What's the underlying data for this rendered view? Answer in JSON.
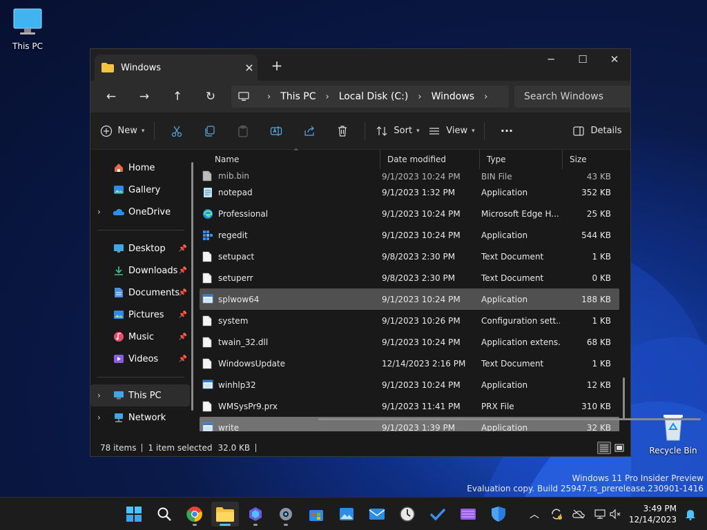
{
  "desktop": {
    "icons": [
      {
        "label": "This PC"
      },
      {
        "label": "Recycle Bin"
      }
    ],
    "watermark": {
      "line1": "Windows 11 Pro Insider Preview",
      "line2": "Evaluation copy. Build 25947.rs_prerelease.230901-1416"
    }
  },
  "window": {
    "tab_title": "Windows",
    "controls": {
      "minimize": "─",
      "maximize": "☐",
      "close": "✕"
    }
  },
  "navbar": {
    "breadcrumb": [
      "This PC",
      "Local Disk (C:)",
      "Windows"
    ],
    "search_placeholder": "Search Windows"
  },
  "commandbar": {
    "new_label": "New",
    "sort_label": "Sort",
    "view_label": "View",
    "more_label": "···",
    "details_label": "Details"
  },
  "sidebar": {
    "items": [
      {
        "label": "Home",
        "icon": "home-icon"
      },
      {
        "label": "Gallery",
        "icon": "gallery-icon"
      },
      {
        "label": "OneDrive",
        "icon": "onedrive-icon"
      },
      {
        "label": "Desktop",
        "icon": "desktop-icon"
      },
      {
        "label": "Downloads",
        "icon": "downloads-icon"
      },
      {
        "label": "Documents",
        "icon": "documents-icon"
      },
      {
        "label": "Pictures",
        "icon": "pictures-icon"
      },
      {
        "label": "Music",
        "icon": "music-icon"
      },
      {
        "label": "Videos",
        "icon": "videos-icon"
      },
      {
        "label": "This PC",
        "icon": "pc-icon"
      },
      {
        "label": "Network",
        "icon": "network-icon"
      }
    ]
  },
  "columns": {
    "name": "Name",
    "date": "Date modified",
    "type": "Type",
    "size": "Size"
  },
  "files": [
    {
      "name": "mib.bin",
      "date": "9/1/2023 10:24 PM",
      "type": "BIN File",
      "size": "43 KB",
      "icon": "file"
    },
    {
      "name": "notepad",
      "date": "9/1/2023 1:32 PM",
      "type": "Application",
      "size": "352 KB",
      "icon": "notepad"
    },
    {
      "name": "Professional",
      "date": "9/1/2023 10:24 PM",
      "type": "Microsoft Edge H...",
      "size": "25 KB",
      "icon": "edge"
    },
    {
      "name": "regedit",
      "date": "9/1/2023 10:24 PM",
      "type": "Application",
      "size": "544 KB",
      "icon": "regedit"
    },
    {
      "name": "setupact",
      "date": "9/8/2023 2:30 PM",
      "type": "Text Document",
      "size": "1 KB",
      "icon": "file"
    },
    {
      "name": "setuperr",
      "date": "9/8/2023 2:30 PM",
      "type": "Text Document",
      "size": "0 KB",
      "icon": "file"
    },
    {
      "name": "splwow64",
      "date": "9/1/2023 10:24 PM",
      "type": "Application",
      "size": "188 KB",
      "icon": "app"
    },
    {
      "name": "system",
      "date": "9/1/2023 10:26 PM",
      "type": "Configuration sett...",
      "size": "1 KB",
      "icon": "file"
    },
    {
      "name": "twain_32.dll",
      "date": "9/1/2023 10:24 PM",
      "type": "Application extens...",
      "size": "68 KB",
      "icon": "file"
    },
    {
      "name": "WindowsUpdate",
      "date": "12/14/2023 2:16 PM",
      "type": "Text Document",
      "size": "1 KB",
      "icon": "file"
    },
    {
      "name": "winhlp32",
      "date": "9/1/2023 10:24 PM",
      "type": "Application",
      "size": "12 KB",
      "icon": "app"
    },
    {
      "name": "WMSysPr9.prx",
      "date": "9/1/2023 11:41 PM",
      "type": "PRX File",
      "size": "310 KB",
      "icon": "file"
    },
    {
      "name": "write",
      "date": "9/1/2023 1:39 PM",
      "type": "Application",
      "size": "32 KB",
      "icon": "app"
    }
  ],
  "statusbar": {
    "count": "78 items",
    "selection": "1 item selected",
    "size": "32.0 KB"
  },
  "taskbar": {
    "time": "3:49 PM",
    "date": "12/14/2023"
  },
  "colors": {
    "accent": "#4cc2ff",
    "folder": "#f5c342"
  }
}
